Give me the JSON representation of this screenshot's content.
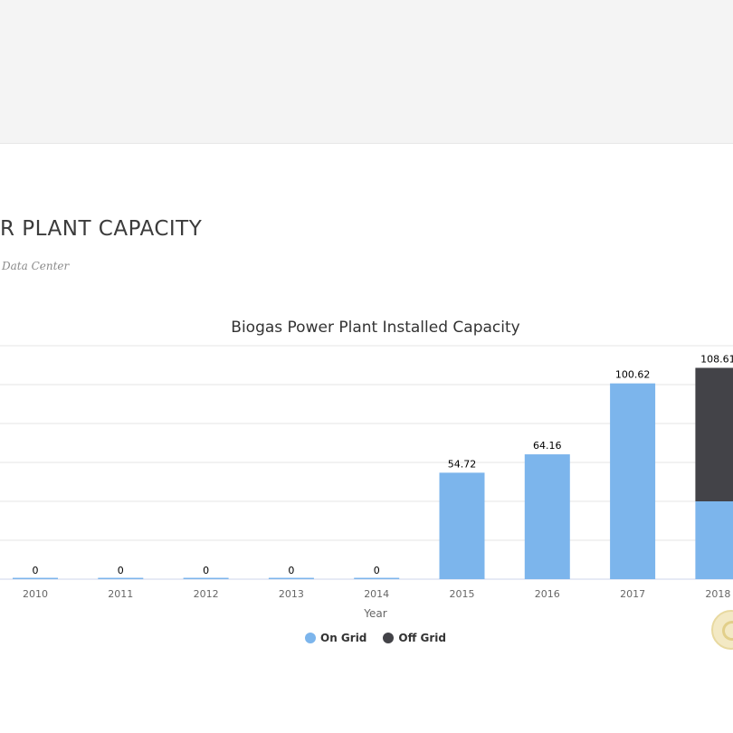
{
  "page": {
    "heading": "R PLANT CAPACITY",
    "subheading": "Data Center"
  },
  "chart_data": {
    "type": "bar",
    "stacked": true,
    "title": "Biogas Power Plant Installed Capacity",
    "xlabel": "Year",
    "ylabel": "",
    "categories": [
      "2010",
      "2011",
      "2012",
      "2013",
      "2014",
      "2015",
      "2016",
      "2017",
      "2018"
    ],
    "series": [
      {
        "name": "On Grid",
        "color": "#7cb5ec",
        "values": [
          0,
          0,
          0,
          0,
          0,
          54.72,
          64.16,
          100.62,
          40
        ]
      },
      {
        "name": "Off Grid",
        "color": "#434348",
        "values": [
          0,
          0,
          0,
          0,
          0,
          0,
          0,
          0,
          68.61
        ]
      }
    ],
    "totals": [
      "0",
      "0",
      "0",
      "0",
      "0",
      "54.72",
      "64.16",
      "100.62",
      "108.61"
    ],
    "ylim": [
      0,
      120
    ],
    "grid": true,
    "legend_position": "bottom"
  }
}
